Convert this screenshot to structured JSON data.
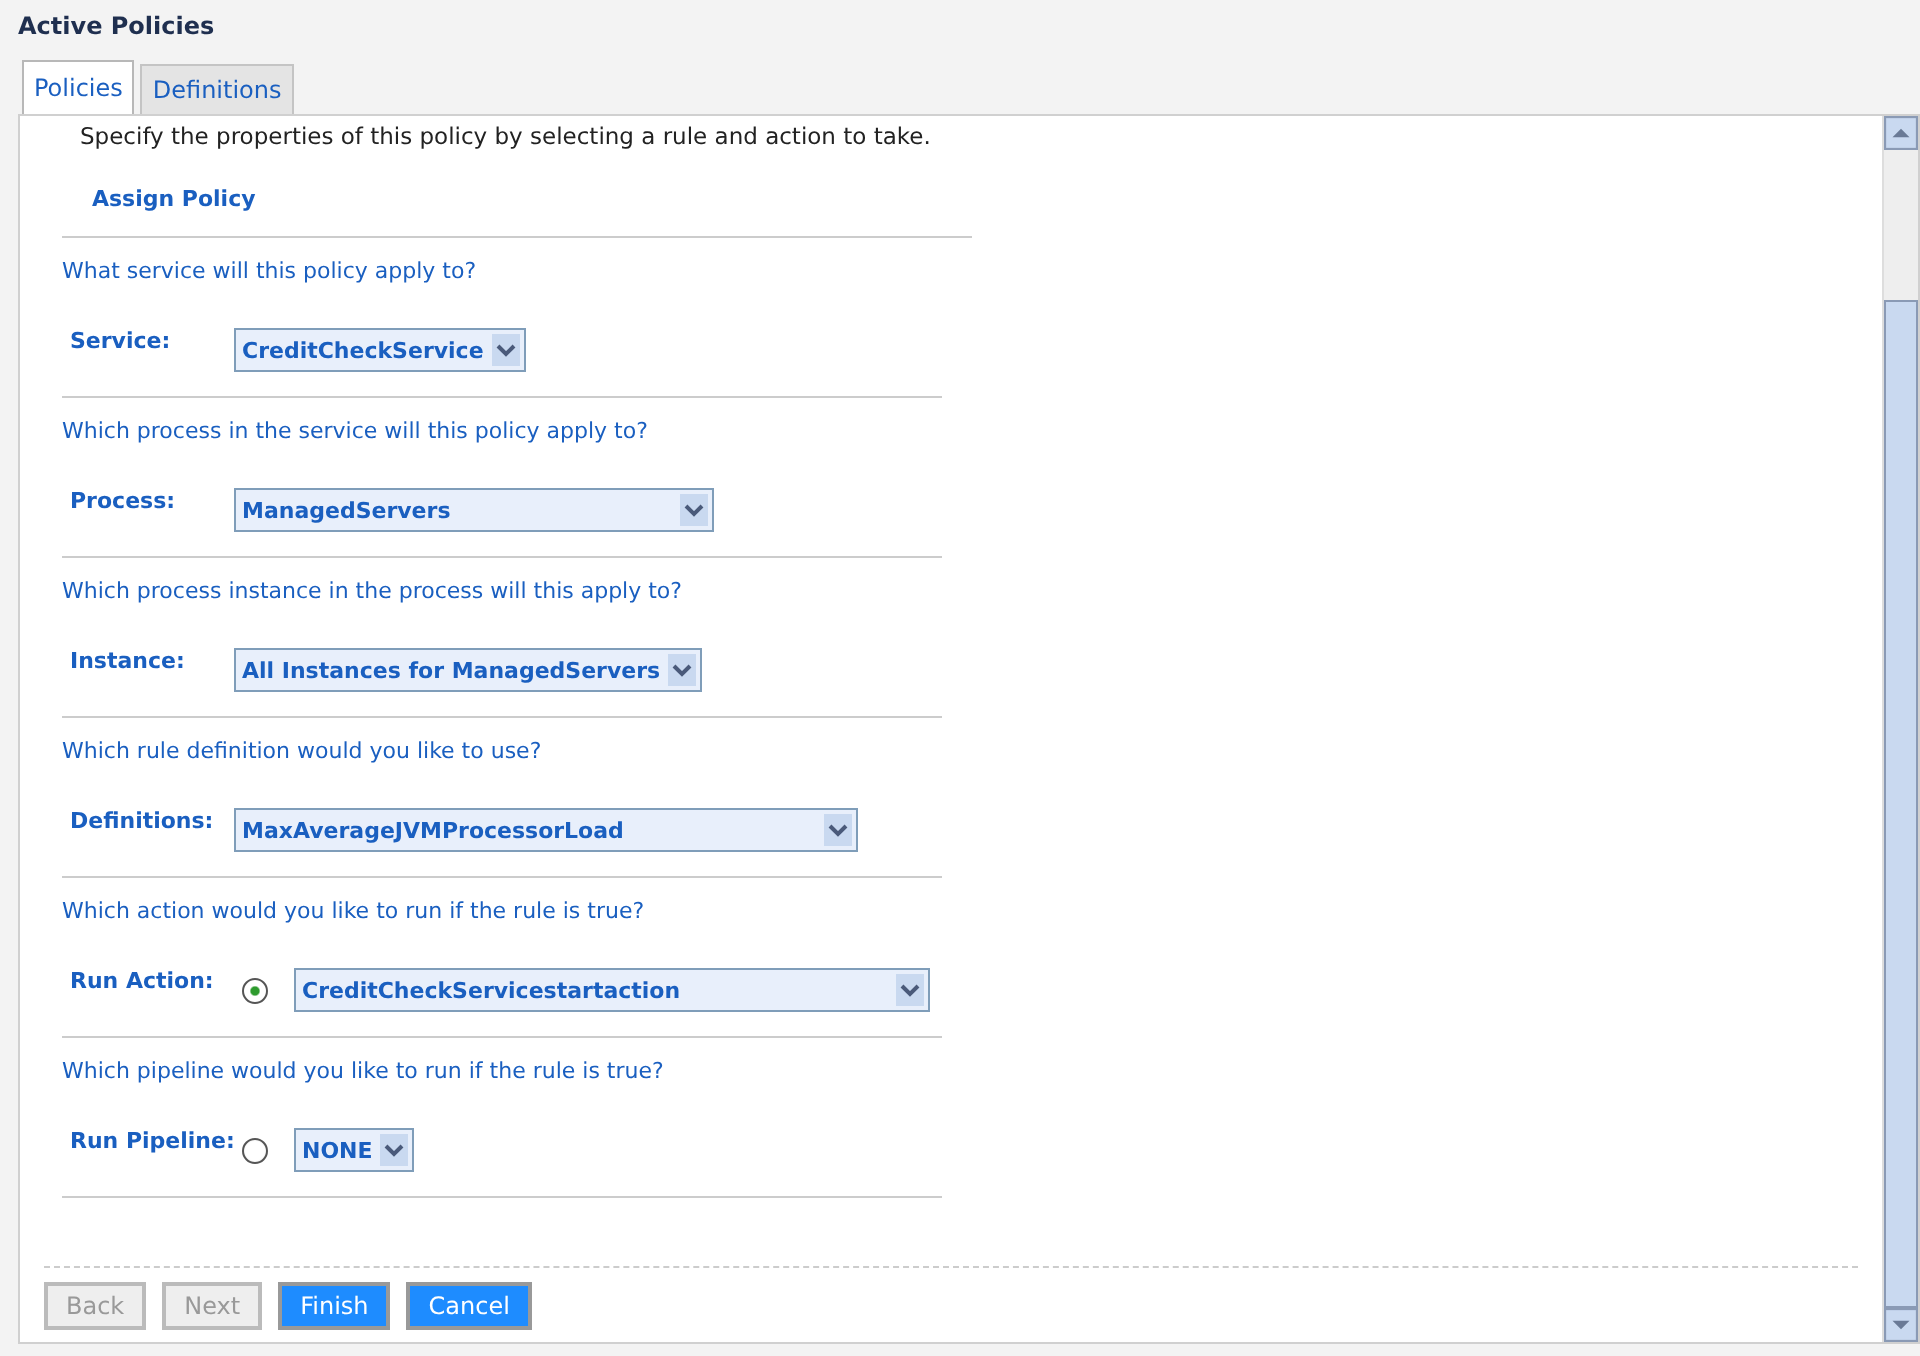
{
  "title": "Active Policies",
  "tabs": [
    {
      "label": "Policies",
      "selected": true
    },
    {
      "label": "Definitions",
      "selected": false
    }
  ],
  "intro": "Specify the properties of this policy by selecting a rule and action to take.",
  "heading": "Assign Policy",
  "sections": [
    {
      "question": "What service will this policy apply to?",
      "label": "Service:",
      "kind": "select",
      "value": "CreditCheckService"
    },
    {
      "question": "Which process in the service will this policy apply to?",
      "label": "Process:",
      "kind": "select",
      "value": "ManagedServers"
    },
    {
      "question": "Which process instance in the process will this apply to?",
      "label": "Instance:",
      "kind": "select",
      "value": "All Instances for ManagedServers"
    },
    {
      "question": "Which rule definition would you like to use?",
      "label": "Definitions:",
      "kind": "select",
      "value": "MaxAverageJVMProcessorLoad"
    },
    {
      "question": "Which action would you like to run if the rule is true?",
      "label": "Run Action:",
      "kind": "radio",
      "selected": true,
      "value": "CreditCheckServicestartaction"
    },
    {
      "question": "Which pipeline would you like to run if the rule is true?",
      "label": "Run Pipeline:",
      "kind": "radio",
      "selected": false,
      "value": "NONE"
    }
  ],
  "buttons": [
    {
      "label": "Back",
      "disabled": true
    },
    {
      "label": "Next",
      "disabled": true
    },
    {
      "label": "Finish",
      "disabled": false
    },
    {
      "label": "Cancel",
      "disabled": false
    }
  ]
}
